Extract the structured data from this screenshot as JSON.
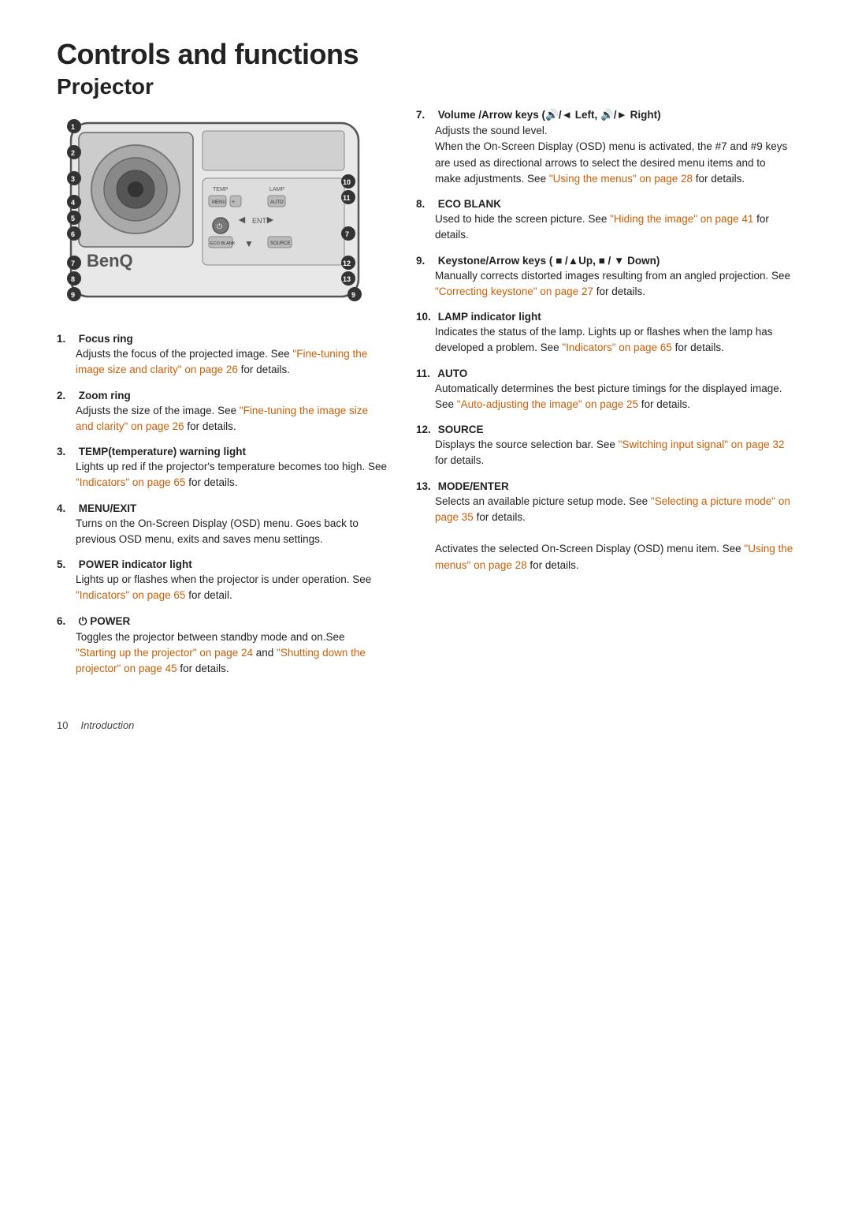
{
  "page": {
    "title": "Controls and functions",
    "subtitle": "Projector",
    "footer_page": "10",
    "footer_section": "Introduction"
  },
  "items_left": [
    {
      "num": "1.",
      "title": "Focus ring",
      "body": "Adjusts the focus of the projected image. See ",
      "link1": "\"Fine-tuning the image size and clarity\" on page 26",
      "body2": " for details."
    },
    {
      "num": "2.",
      "title": "Zoom ring",
      "body": "Adjusts the size of the image. See ",
      "link1": "\"Fine-tuning the image size and clarity\" on page 26",
      "body2": " for details."
    },
    {
      "num": "3.",
      "title": "TEMP(temperature) warning light",
      "body": "Lights up red if the projector's temperature becomes too high. See ",
      "link1": "\"Indicators\" on page 65",
      "body2": " for details."
    },
    {
      "num": "4.",
      "title": "MENU/EXIT",
      "body": "Turns on the On-Screen Display (OSD) menu. Goes back to previous OSD menu, exits and saves menu settings."
    },
    {
      "num": "5.",
      "title": "POWER indicator light",
      "body": "Lights up or flashes when the projector is under operation. See ",
      "link1": "\"Indicators\" on page 65",
      "body2": " for detail."
    },
    {
      "num": "6.",
      "title": "⏻ POWER",
      "body": "Toggles the projector between standby mode and on.See ",
      "link1": "\"Starting up the projector\" on page 24",
      "body_mid": " and ",
      "link2": "\"Shutting down the projector\" on page 45",
      "body2": " for details."
    }
  ],
  "items_right": [
    {
      "num": "7.",
      "title": "Volume /Arrow keys (🔊/◄ Left, 🔊/► Right)",
      "title_plain": "Volume /Arrow keys ( ◄ /◄  Left, ◄ /►  Right)",
      "body": "Adjusts the sound level.\nWhen the On-Screen Display (OSD) menu is activated, the #7 and #9 keys are used as directional arrows to select the desired menu items and to make adjustments. See ",
      "link1": "\"Using the menus\" on page 28",
      "body2": " for details."
    },
    {
      "num": "8.",
      "title": "ECO BLANK",
      "body": "Used to hide the screen picture. See ",
      "link1": "\"Hiding the image\" on page 41",
      "body2": " for details."
    },
    {
      "num": "9.",
      "title": "Keystone/Arrow keys ( ▼ /▲Up,  ▼ / ▼ Down)",
      "title_plain": "Keystone/Arrow keys ( ■ /▲Up,  ■ / ▼ Down)",
      "body": "Manually corrects distorted images resulting from an angled projection. See ",
      "link1": "\"Correcting keystone\" on page 27",
      "body2": " for details."
    },
    {
      "num": "10.",
      "title": "LAMP indicator light",
      "body": "Indicates the status of the lamp. Lights up or flashes when the lamp has developed a problem. See ",
      "link1": "\"Indicators\" on page 65",
      "body2": " for details."
    },
    {
      "num": "11.",
      "title": "AUTO",
      "body": "Automatically determines the best picture timings for the displayed image. See ",
      "link1": "\"Auto-adjusting the image\" on page 25",
      "body2": " for details."
    },
    {
      "num": "12.",
      "title": "SOURCE",
      "body": "Displays the source selection bar. See ",
      "link1": "\"Switching input signal\" on page 32",
      "body2": " for details."
    },
    {
      "num": "13.",
      "title": "MODE/ENTER",
      "body": "Selects an available picture setup mode. See ",
      "link1": "\"Selecting a picture mode\" on page 35",
      "body2": " for details.\n\nActivates the selected On-Screen Display (OSD) menu item. See ",
      "link3": "\"Using the menus\" on page 28",
      "body3": " for details."
    }
  ],
  "link_color": "#c8600a"
}
